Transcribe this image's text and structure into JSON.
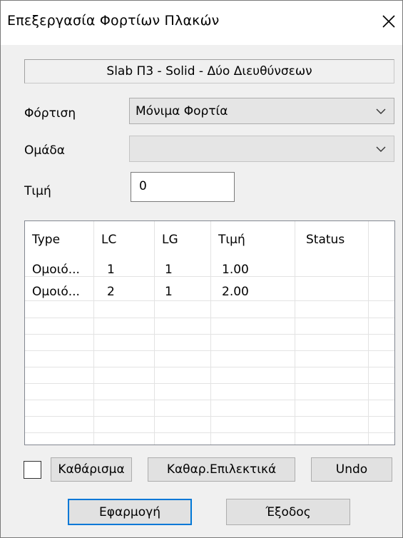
{
  "window": {
    "title": "Επεξεργασία Φορτίων Πλακών",
    "close_glyph": "✕"
  },
  "info": {
    "text": "Slab Π3 - Solid - Δύο Διευθύνσεων"
  },
  "form": {
    "loading_label": "Φόρτιση",
    "loading_value": "Μόνιμα Φορτία",
    "group_label": "Ομάδα",
    "group_value": "",
    "value_label": "Τιμή",
    "value_input": "0"
  },
  "table": {
    "columns": [
      "Type",
      "LC",
      "LG",
      "Τιμή",
      "Status"
    ],
    "rows": [
      {
        "type": "Ομοιό...",
        "lc": "1",
        "lg": "1",
        "value": "1.00",
        "status": ""
      },
      {
        "type": "Ομοιό...",
        "lc": "2",
        "lg": "1",
        "value": "2.00",
        "status": ""
      }
    ]
  },
  "buttons": {
    "clear": "Καθάρισμα",
    "clear_selective": "Καθαρ.Επιλεκτικά",
    "undo": "Undo",
    "apply": "Εφαρμογή",
    "exit": "Έξοδος"
  },
  "icons": {
    "close": "close-icon",
    "dropdown": "chevron-down-icon"
  },
  "colors": {
    "default_button_border": "#0078d7",
    "dialog_bg": "#f0f0f0"
  }
}
